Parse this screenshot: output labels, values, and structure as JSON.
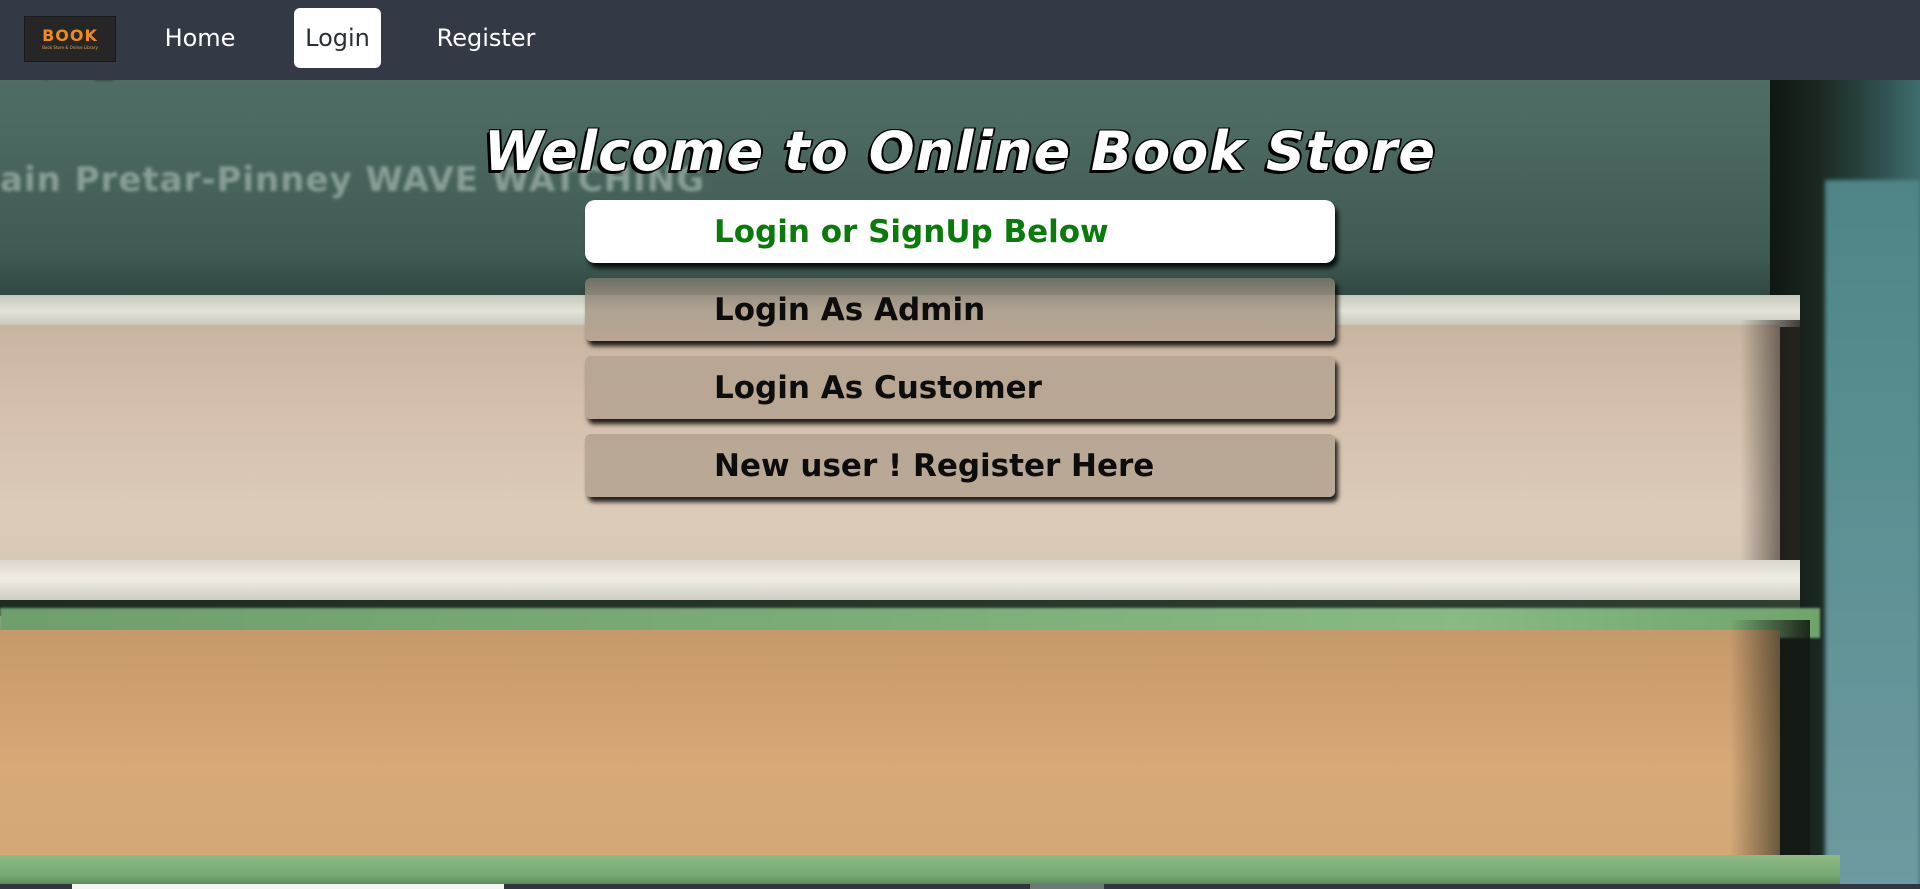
{
  "navbar": {
    "logo": {
      "word": "BOOK",
      "tagline": "Book Store & Online Library",
      "brand_color": "#f08a1a"
    },
    "links": [
      {
        "label": "Home",
        "active": false
      },
      {
        "label": "Login",
        "active": true
      },
      {
        "label": "Register",
        "active": false
      }
    ],
    "background_color": "#343a45"
  },
  "background": {
    "spine_text": "ain Pretar-Pinney   WAVE WATCHING"
  },
  "main": {
    "welcome_title": "Welcome to Online Book Store",
    "menu": {
      "header": "Login or SignUp Below",
      "header_color": "#0a7a0a",
      "items": [
        {
          "label": "Login As Admin"
        },
        {
          "label": "Login As Customer"
        },
        {
          "label": "New user ! Register Here"
        }
      ]
    }
  }
}
